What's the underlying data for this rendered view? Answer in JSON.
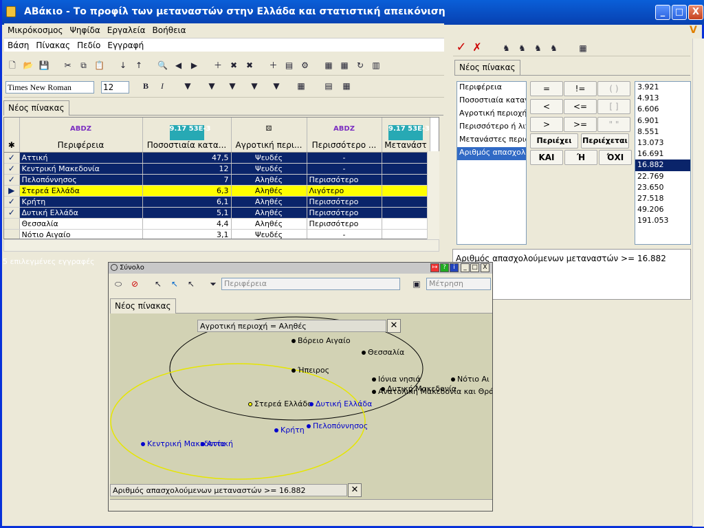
{
  "window": {
    "title": "ΑΒάκιο - Το προφίλ των μεταναστών στην Ελλάδα και στατιστική απεικόνιση",
    "min": "_",
    "max": "□",
    "close": "X"
  },
  "menu1": [
    "Μικρόκοσμος",
    "Ψηφίδα",
    "Εργαλεία",
    "Βοήθεια"
  ],
  "menu2": [
    "Βάση",
    "Πίνακας",
    "Πεδίο",
    "Εγγραφή"
  ],
  "font": {
    "name": "Times New Roman",
    "size": "12"
  },
  "tab_label": "Νέος πίνακας",
  "grid": {
    "columns": [
      {
        "icon": "text-field-icon",
        "label": "Περιφέρεια"
      },
      {
        "icon": "numeric-field-icon",
        "label": "Ποσοστιαία κατα..."
      },
      {
        "icon": "boolean-field-icon",
        "label": "Αγροτική περι..."
      },
      {
        "icon": "text-field-icon",
        "label": "Περισσότερο ..."
      },
      {
        "icon": "numeric-field-icon",
        "label": "Μετανάστ"
      }
    ],
    "rows": [
      {
        "mark": "✓",
        "style": "blue",
        "cells": [
          "Αττική",
          "47,5",
          "Ψευδές",
          "-"
        ]
      },
      {
        "mark": "✓",
        "style": "blue",
        "cells": [
          "Κεντρική Μακεδονία",
          "12",
          "Ψευδές",
          "-"
        ]
      },
      {
        "mark": "✓",
        "style": "blue",
        "cells": [
          "Πελοπόννησος",
          "7",
          "Αληθές",
          "Περισσότερο"
        ]
      },
      {
        "mark": "▶",
        "style": "yel",
        "cells": [
          "Στερεά Ελλάδα",
          "6,3",
          "Αληθές",
          "Λιγότερο"
        ]
      },
      {
        "mark": "✓",
        "style": "blue",
        "cells": [
          "Κρήτη",
          "6,1",
          "Αληθές",
          "Περισσότερο"
        ]
      },
      {
        "mark": "✓",
        "style": "blue",
        "cells": [
          "Δυτική Ελλάδα",
          "5,1",
          "Αληθές",
          "Περισσότερο"
        ]
      },
      {
        "mark": "",
        "style": "",
        "cells": [
          "Θεσσαλία",
          "4,4",
          "Αληθές",
          "Περισσότερο"
        ]
      },
      {
        "mark": "",
        "style": "",
        "cells": [
          "Νότιο Αιγαίο",
          "3,1",
          "Ψευδές",
          "-"
        ]
      }
    ]
  },
  "status": {
    "selected": "5 επιλεγμένες εγγραφές"
  },
  "query": {
    "tab": "Νέος πίνακας",
    "fields": [
      "Περιφέρεια",
      "Ποσοστιαία κατανο",
      "Αγροτική περιοχή",
      "Περισσότερο ή λιγό",
      "Μετανάστες περιφέ",
      "Αριθμός απασχολο"
    ],
    "selected_field_index": 5,
    "operators": [
      [
        "=",
        "!=",
        "( )"
      ],
      [
        "<",
        "<=",
        "[ ]"
      ],
      [
        ">",
        ">=",
        "\" \""
      ]
    ],
    "ops_extra": [
      "Περιέχει",
      "Περιέχεται"
    ],
    "logic": [
      "ΚΑΙ",
      "Ή",
      "ΌΧΙ"
    ],
    "values": [
      "3.921",
      "4.913",
      "6.606",
      "6.901",
      "8.551",
      "13.073",
      "16.691",
      "16.882",
      "22.769",
      "23.650",
      "27.518",
      "49.206",
      "191.053"
    ],
    "selected_value_index": 7,
    "condition": "Αριθμός απασχολούμενων μεταναστών >= 16.882"
  },
  "float": {
    "title": "Σύνολο",
    "group_field": "Περιφέρεια",
    "measure": "Μέτρηση",
    "tab": "Νέος πίνακας",
    "filter1": "Αγροτική περιοχή = Αληθές",
    "filter2": "Αριθμός απασχολούμενων μεταναστών >= 16.882",
    "points": [
      "Βόρειο Αιγαίο",
      "Θεσσαλία",
      "Ήπειρος",
      "Ιόνια νησιά",
      "Νότιο Αι",
      "Δυτική Μακεδονία",
      "Ανατολική Μακεδονία και Θρά",
      "Στερεά Ελλάδα",
      "Δυτική Ελλάδα",
      "Πελοπόννησος",
      "Κρήτη",
      "Κεντρική Μακεδονία",
      "Αττική"
    ]
  }
}
